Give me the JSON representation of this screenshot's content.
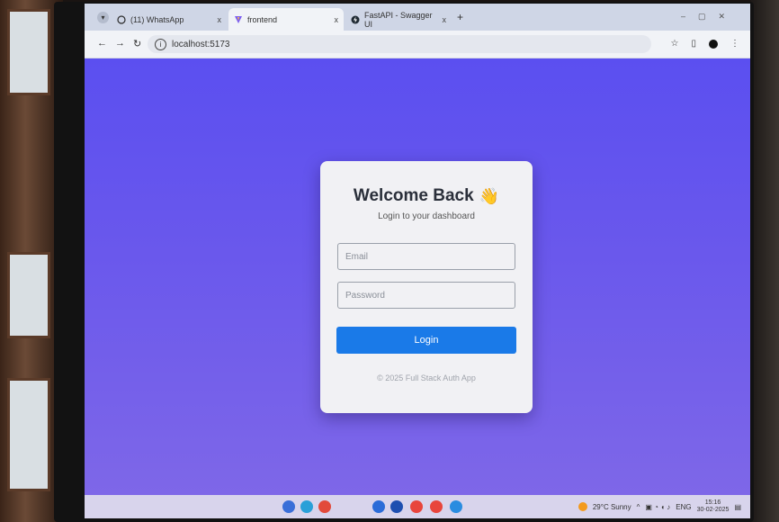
{
  "browser": {
    "tabs": [
      {
        "label": "(11) WhatsApp",
        "icon": "whatsapp-icon",
        "close": "x"
      },
      {
        "label": "frontend",
        "icon": "vite-icon",
        "close": "x"
      },
      {
        "label": "FastAPI - Swagger UI",
        "icon": "fastapi-icon",
        "close": "x"
      }
    ],
    "new_tab": "+",
    "address": "localhost:5173"
  },
  "login": {
    "title": "Welcome Back",
    "title_emoji": "👋",
    "subtitle": "Login to your dashboard",
    "email_placeholder": "Email",
    "password_placeholder": "Password",
    "login_label": "Login",
    "footer": "© 2025 Full Stack Auth App"
  },
  "taskbar": {
    "weather": "29°C Sunny",
    "language": "ENG",
    "time": "15:16",
    "date": "30-02-2025"
  },
  "colors": {
    "page_gradient_top": "#5b4ff0",
    "page_gradient_bottom": "#7e67e8",
    "accent_button": "#1a7ae8",
    "card_bg": "#f1f1f4"
  }
}
